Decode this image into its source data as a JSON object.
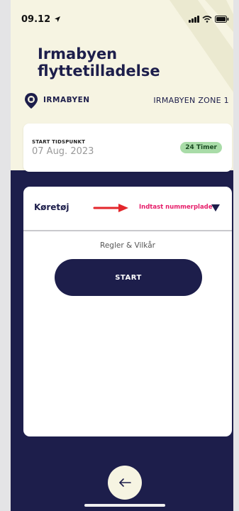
{
  "status_bar": {
    "time": "09.12"
  },
  "header": {
    "title_line1": "Irmabyen",
    "title_line2": "flyttetilladelse"
  },
  "location": {
    "name": "IRMABYEN",
    "zone": "IRMABYEN ZONE 1"
  },
  "start_card": {
    "label": "START TIDSPUNKT",
    "date": "07 Aug. 2023",
    "duration_badge": "24 Timer"
  },
  "vehicle": {
    "label": "Køretøj",
    "plate_placeholder": "Indtast nummerplade"
  },
  "terms_label": "Regler & Vilkår",
  "start_button_label": "START",
  "colors": {
    "navy": "#1d1e4b",
    "cream": "#f6f4e2",
    "pink_accent": "#e61e6a",
    "badge_green": "#a9dca8",
    "annotation_red": "#e3262b"
  },
  "icons": [
    "location-arrow-icon",
    "signal-icon",
    "wifi-icon",
    "battery-icon",
    "location-pin-icon",
    "red-arrow-icon",
    "triangle-down-icon",
    "back-arrow-icon"
  ]
}
